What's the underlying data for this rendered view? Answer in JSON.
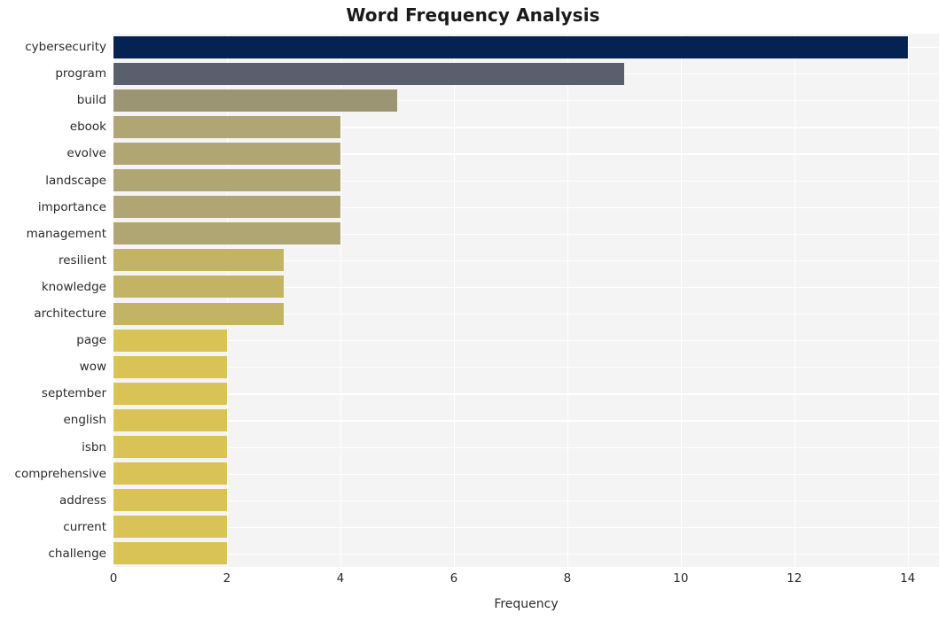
{
  "chart_data": {
    "type": "bar",
    "orientation": "horizontal",
    "title": "Word Frequency Analysis",
    "xlabel": "Frequency",
    "ylabel": "",
    "categories": [
      "cybersecurity",
      "program",
      "build",
      "ebook",
      "evolve",
      "landscape",
      "importance",
      "management",
      "resilient",
      "knowledge",
      "architecture",
      "page",
      "wow",
      "september",
      "english",
      "isbn",
      "comprehensive",
      "address",
      "current",
      "challenge"
    ],
    "values": [
      14,
      9,
      5,
      4,
      4,
      4,
      4,
      4,
      3,
      3,
      3,
      2,
      2,
      2,
      2,
      2,
      2,
      2,
      2,
      2
    ],
    "bar_colors": [
      "#042352",
      "#5a5f6e",
      "#9c9573",
      "#b0a674",
      "#b0a674",
      "#b0a674",
      "#b0a674",
      "#b0a674",
      "#c3b465",
      "#c3b465",
      "#c3b465",
      "#d9c356",
      "#d9c356",
      "#d9c356",
      "#d9c356",
      "#d9c356",
      "#d9c356",
      "#d9c356",
      "#d9c356",
      "#d9c356"
    ],
    "xlim": [
      0,
      14.55
    ],
    "xticks": [
      0,
      2,
      4,
      6,
      8,
      10,
      12,
      14
    ],
    "xtick_labels": [
      "0",
      "2",
      "4",
      "6",
      "8",
      "10",
      "12",
      "14"
    ],
    "grid": true,
    "grid_color": "#ffffff",
    "plot_background": "#f4f4f5",
    "figure_background": "#ffffff",
    "legend": null
  }
}
